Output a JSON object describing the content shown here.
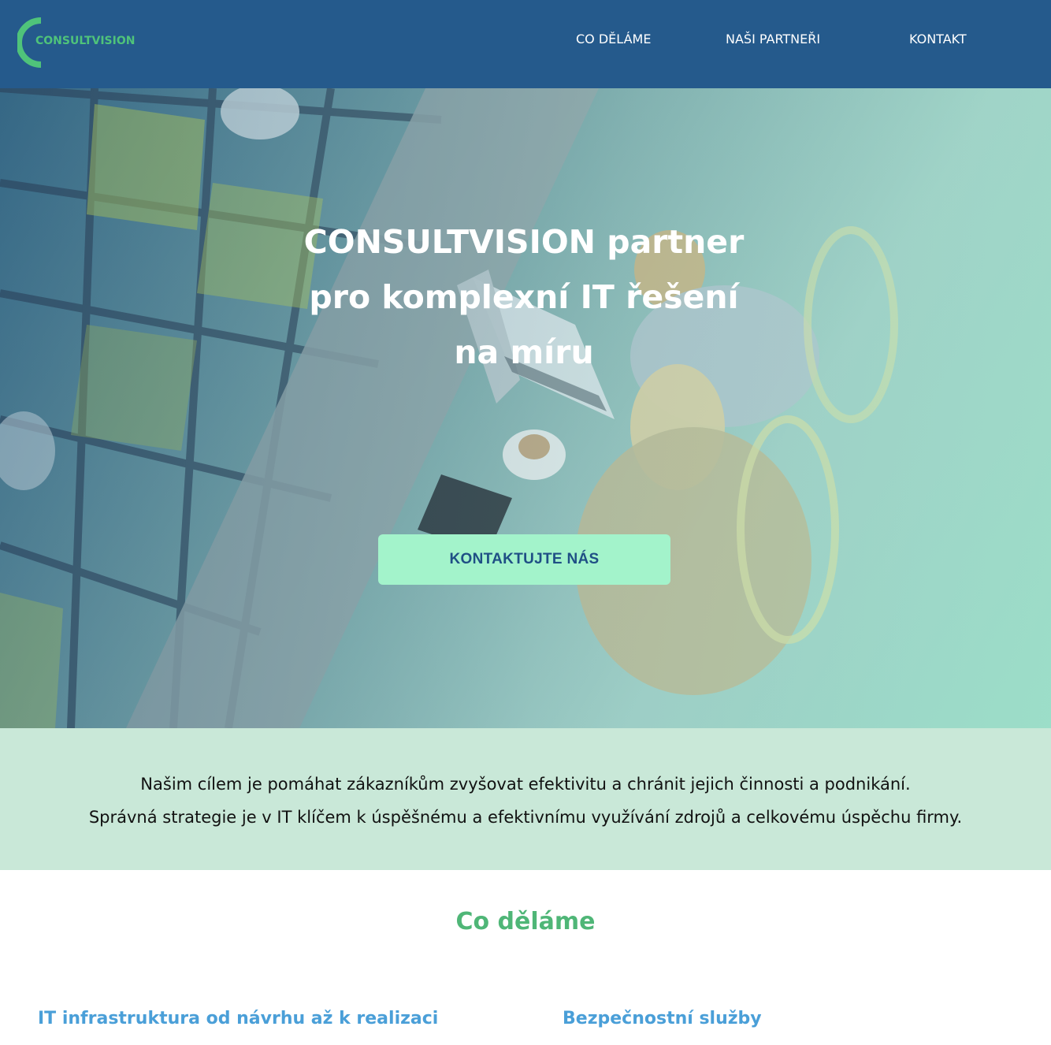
{
  "header": {
    "logo_text": "CONSULTVISION",
    "nav": [
      {
        "label": "CO DĚLÁME"
      },
      {
        "label": "NAŠI PARTNEŘI"
      },
      {
        "label": "KONTAKT"
      }
    ]
  },
  "hero": {
    "title": "CONSULTVISION partner pro komplexní IT řešení na míru",
    "cta_label": "KONTAKTUJTE NÁS"
  },
  "mission": {
    "line1": "Našim cílem je pomáhat zákazníkům zvyšovat efektivitu a chránit jejich činnosti a podnikání.",
    "line2": "Správná strategie je v IT klíčem k úspěšnému a efektivnímu využívání zdrojů a celkovému úspěchu firmy."
  },
  "services": {
    "title": "Co děláme",
    "items": [
      {
        "title": "IT infrastruktura od návrhu až k realizaci"
      },
      {
        "title": "Bezpečnostní služby"
      }
    ]
  },
  "colors": {
    "header_bg": "#255a8c",
    "brand_green": "#4fc37a",
    "cta_bg": "#a3f3cb",
    "mission_bg": "#c9e8d8",
    "service_title": "#4a9fd8"
  }
}
